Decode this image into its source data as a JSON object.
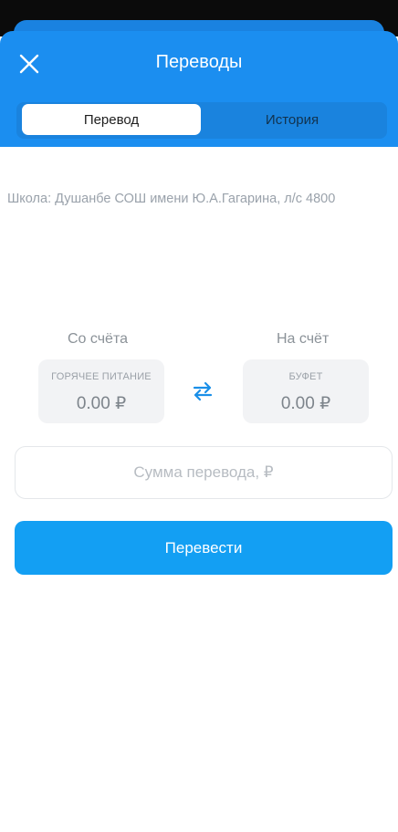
{
  "header": {
    "title": "Переводы",
    "close_icon": "close-icon"
  },
  "tabs": [
    {
      "label": "Перевод",
      "active": true
    },
    {
      "label": "История",
      "active": false
    }
  ],
  "school_info": "Школа: Душанбе СОШ имени Ю.А.Гагарина, л/с 4800",
  "from_account": {
    "label": "Со счёта",
    "name": "ГОРЯЧЕЕ ПИТАНИЕ",
    "amount": "0.00 ₽"
  },
  "to_account": {
    "label": "На счёт",
    "name": "БУФЕТ",
    "amount": "0.00 ₽"
  },
  "swap_icon": "swap-arrows-icon",
  "amount_field": {
    "placeholder": "Сумма перевода, ₽",
    "value": ""
  },
  "submit_button": {
    "label": "Перевести"
  },
  "colors": {
    "header": "#1b8ef0",
    "primary_button": "#139ff3",
    "swap_icon": "#1a8fe8"
  }
}
